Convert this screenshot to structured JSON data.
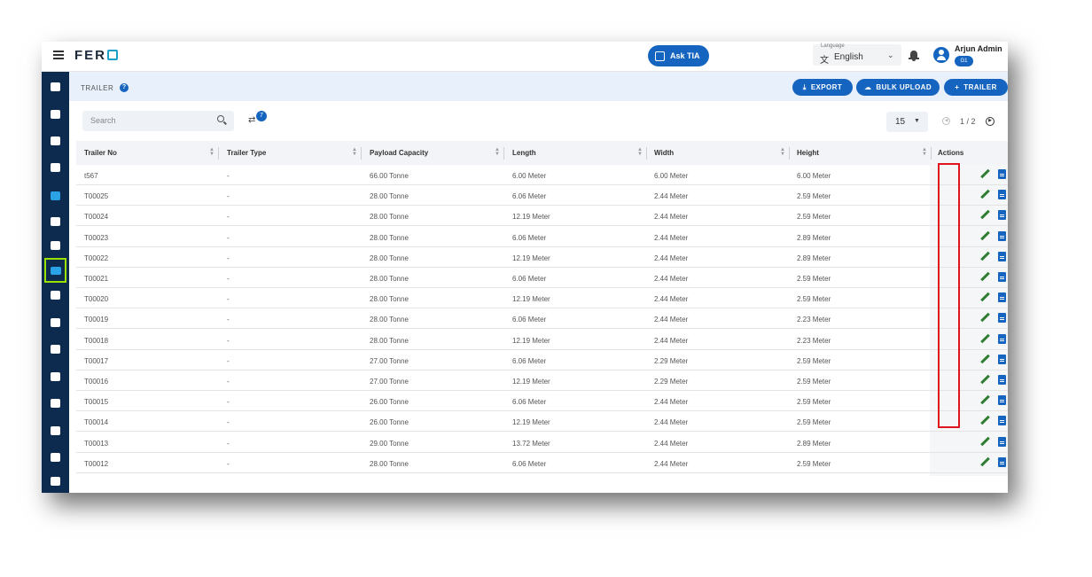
{
  "topbar": {
    "logo_text": "FER",
    "ask_label": "Ask TIA",
    "language_label": "Language",
    "language_value": "English",
    "user_name": "Arjun Admin",
    "user_badge": "G1"
  },
  "header": {
    "title": "TRAILER",
    "help": "?",
    "export_label": "EXPORT",
    "bulk_upload_label": "BULK UPLOAD",
    "add_label": "TRAILER"
  },
  "toolbar": {
    "search_placeholder": "Search",
    "filter_count": "7",
    "page_size": "15",
    "pagination": "1 / 2"
  },
  "table": {
    "columns": [
      "Trailer No",
      "Trailer Type",
      "Payload Capacity",
      "Length",
      "Width",
      "Height",
      "Actions"
    ],
    "rows": [
      [
        "t567",
        "-",
        "66.00 Tonne",
        "6.00 Meter",
        "6.00 Meter",
        "6.00 Meter"
      ],
      [
        "T00025",
        "-",
        "28.00 Tonne",
        "6.06 Meter",
        "2.44 Meter",
        "2.59 Meter"
      ],
      [
        "T00024",
        "-",
        "28.00 Tonne",
        "12.19 Meter",
        "2.44 Meter",
        "2.59 Meter"
      ],
      [
        "T00023",
        "-",
        "28.00 Tonne",
        "6.06 Meter",
        "2.44 Meter",
        "2.89 Meter"
      ],
      [
        "T00022",
        "-",
        "28.00 Tonne",
        "12.19 Meter",
        "2.44 Meter",
        "2.89 Meter"
      ],
      [
        "T00021",
        "-",
        "28.00 Tonne",
        "6.06 Meter",
        "2.44 Meter",
        "2.59 Meter"
      ],
      [
        "T00020",
        "-",
        "28.00 Tonne",
        "12.19 Meter",
        "2.44 Meter",
        "2.59 Meter"
      ],
      [
        "T00019",
        "-",
        "28.00 Tonne",
        "6.06 Meter",
        "2.44 Meter",
        "2.23 Meter"
      ],
      [
        "T00018",
        "-",
        "28.00 Tonne",
        "12.19 Meter",
        "2.44 Meter",
        "2.23 Meter"
      ],
      [
        "T00017",
        "-",
        "27.00 Tonne",
        "6.06 Meter",
        "2.29 Meter",
        "2.59 Meter"
      ],
      [
        "T00016",
        "-",
        "27.00 Tonne",
        "12.19 Meter",
        "2.29 Meter",
        "2.59 Meter"
      ],
      [
        "T00015",
        "-",
        "26.00 Tonne",
        "6.06 Meter",
        "2.44 Meter",
        "2.59 Meter"
      ],
      [
        "T00014",
        "-",
        "26.00 Tonne",
        "12.19 Meter",
        "2.44 Meter",
        "2.59 Meter"
      ],
      [
        "T00013",
        "-",
        "29.00 Tonne",
        "13.72 Meter",
        "2.44 Meter",
        "2.89 Meter"
      ],
      [
        "T00012",
        "-",
        "28.00 Tonne",
        "6.06 Meter",
        "2.44 Meter",
        "2.59 Meter"
      ]
    ]
  },
  "sidebar": {
    "items": [
      "dashboard-icon",
      "box-settings-icon",
      "bus-icon",
      "ticket-icon",
      "truck-fast-icon",
      "truck-icon",
      "person-icon",
      "trailer-icon",
      "driver-voice-icon",
      "building-grid-icon",
      "company-icon",
      "route-icon",
      "report-icon",
      "settings-icon",
      "document-icon",
      "gallery-icon"
    ]
  },
  "colors": {
    "primary": "#1565c0",
    "sidebar": "#0d2b4e",
    "active_outline": "#9be000",
    "highlight": "#e0141e",
    "edit": "#2e7d32"
  }
}
